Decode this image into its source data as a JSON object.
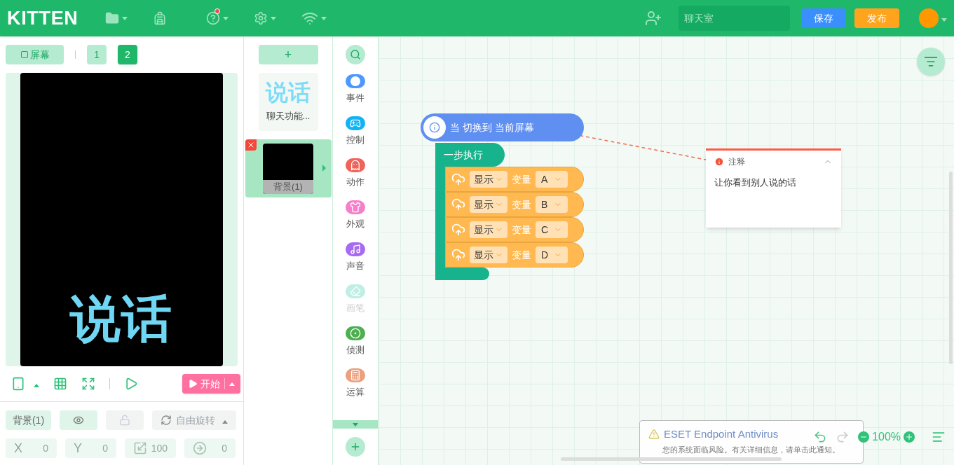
{
  "header": {
    "logo": "KITTEN",
    "help_unread": true,
    "chat": {
      "placeholder": "聊天室"
    },
    "save": "保存",
    "publish": "发布"
  },
  "stage": {
    "screen_button": "屏幕",
    "screens": [
      {
        "label": "1",
        "selected": false
      },
      {
        "label": "2",
        "selected": true
      }
    ],
    "preview_text": "说话",
    "start": "开始"
  },
  "properties": {
    "sprite": "背景(1)",
    "rotation": "自由旋转",
    "fields": [
      {
        "kind": "x",
        "label": "X",
        "value": "0"
      },
      {
        "kind": "y",
        "label": "Y",
        "value": "0"
      },
      {
        "kind": "scale",
        "value": "100"
      },
      {
        "kind": "angle",
        "value": "0"
      }
    ]
  },
  "sprites": {
    "add": "+",
    "items": [
      {
        "name": "聊天功能...",
        "thumb_text": "说话",
        "selected": false
      },
      {
        "name": "背景(1)",
        "selected": true
      }
    ]
  },
  "categories": [
    {
      "kind": "toggle",
      "label": "事件",
      "color": "#4d97ff",
      "disabled": false
    },
    {
      "kind": "gamepad",
      "label": "控制",
      "color": "#0fb3f6",
      "disabled": false
    },
    {
      "kind": "ghost",
      "label": "动作",
      "color": "#f0635a",
      "disabled": false
    },
    {
      "kind": "shirt",
      "label": "外观",
      "color": "#f57fca",
      "disabled": false
    },
    {
      "kind": "music",
      "label": "声音",
      "color": "#a66bf0",
      "disabled": false
    },
    {
      "kind": "pen",
      "label": "画笔",
      "color": "#bfeee5",
      "disabled": true
    },
    {
      "kind": "target",
      "label": "侦测",
      "color": "#4caf50",
      "disabled": false
    },
    {
      "kind": "calc",
      "label": "运算",
      "color": "#eba07f",
      "disabled": false
    }
  ],
  "canvas": {
    "hat": "当 切换到 当前屏幕",
    "loop": "一步执行",
    "rows": [
      {
        "action": "显示",
        "label": "变量",
        "variable": "A"
      },
      {
        "action": "显示",
        "label": "变量",
        "variable": "B"
      },
      {
        "action": "显示",
        "label": "变量",
        "variable": "C"
      },
      {
        "action": "显示",
        "label": "变量",
        "variable": "D"
      }
    ],
    "comment": {
      "title": "注释",
      "text": "让你看到别人说的话"
    },
    "zoom": "100%"
  },
  "notification": {
    "title": "ESET Endpoint Antivirus",
    "message": "您的系统面临风险。有关详细信息，请单击此通知。"
  }
}
